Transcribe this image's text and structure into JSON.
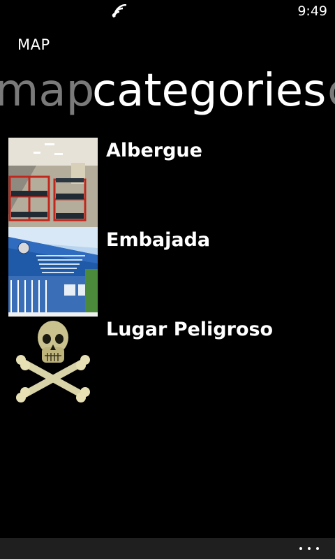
{
  "status_bar": {
    "time": "9:49",
    "signal_icon": "wifi-signal-icon"
  },
  "app": {
    "title": "MAP"
  },
  "pivot": {
    "previous": "map",
    "current": "categories",
    "next": "c"
  },
  "categories": [
    {
      "label": "Albergue",
      "thumbnail": "hostel-bunk-beds-photo"
    },
    {
      "label": "Embajada",
      "thumbnail": "consulate-building-photo"
    },
    {
      "label": "Lugar Peligroso",
      "thumbnail": "skull-crossbones-image"
    }
  ],
  "app_bar": {
    "more_icon": "ellipsis-icon"
  },
  "colors": {
    "background": "#000000",
    "foreground": "#ffffff",
    "inactive_pivot": "#7a7a7a",
    "app_bar": "#1f1f1f"
  }
}
